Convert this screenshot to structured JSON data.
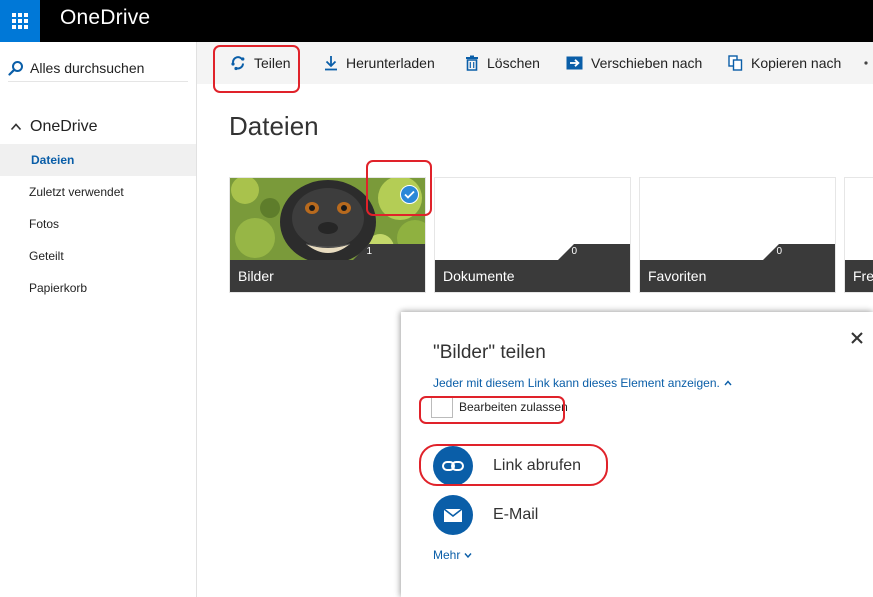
{
  "app": {
    "title": "OneDrive"
  },
  "sidebar": {
    "search_label": "Alles durchsuchen",
    "section_label": "OneDrive",
    "items": [
      {
        "label": "Dateien",
        "active": true
      },
      {
        "label": "Zuletzt verwendet",
        "active": false
      },
      {
        "label": "Fotos",
        "active": false
      },
      {
        "label": "Geteilt",
        "active": false
      },
      {
        "label": "Papierkorb",
        "active": false
      }
    ]
  },
  "toolbar": {
    "share_label": "Teilen",
    "download_label": "Herunterladen",
    "delete_label": "Löschen",
    "move_label": "Verschieben nach",
    "copy_label": "Kopieren nach"
  },
  "main": {
    "title": "Dateien",
    "folders": [
      {
        "name": "Bilder",
        "count": "1",
        "selected": true
      },
      {
        "name": "Dokumente",
        "count": "0",
        "selected": false
      },
      {
        "name": "Favoriten",
        "count": "0",
        "selected": false
      },
      {
        "name": "Fre",
        "count": "",
        "selected": false
      }
    ]
  },
  "share_dialog": {
    "title": "\"Bilder\" teilen",
    "permission_text": "Jeder mit diesem Link kann dieses Element anzeigen.",
    "allow_edit_label": "Bearbeiten zulassen",
    "get_link_label": "Link abrufen",
    "email_label": "E-Mail",
    "more_label": "Mehr"
  },
  "colors": {
    "accent": "#0078d7",
    "link_blue": "#0a5ea8",
    "highlight_red": "#e0222a",
    "caption_bg": "#3a3a3a",
    "topbar_bg": "#000000"
  }
}
